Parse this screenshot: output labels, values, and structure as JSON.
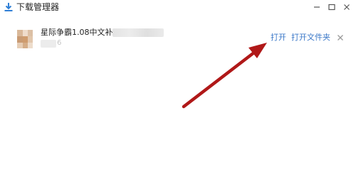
{
  "window": {
    "title": "下载管理器",
    "title_icon": "download-icon",
    "controls": [
      "minimize-icon",
      "maximize-icon",
      "close-icon"
    ]
  },
  "download_item": {
    "file_name": "星际争霸1.08中文补丁_2",
    "meta_text": "6",
    "open_label": "打开",
    "open_folder_label": "打开文件夹",
    "remove_icon": "close-icon"
  },
  "colors": {
    "link": "#3b78c8",
    "title_icon": "#2f7fd6",
    "annotation_arrow": "#b01818"
  }
}
